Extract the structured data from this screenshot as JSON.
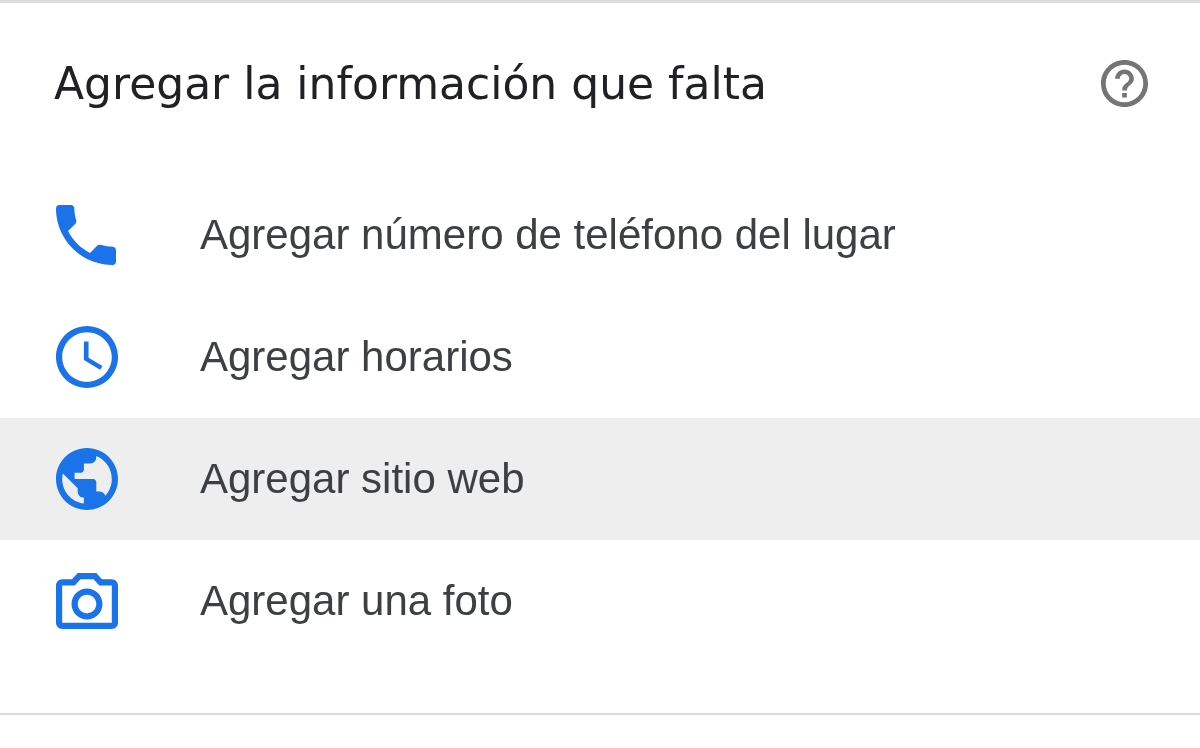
{
  "section": {
    "title": "Agregar la información que falta"
  },
  "items": [
    {
      "kind": "phone",
      "label": "Agregar número de teléfono del lugar",
      "highlighted": false
    },
    {
      "kind": "clock",
      "label": "Agregar horarios",
      "highlighted": false
    },
    {
      "kind": "globe",
      "label": "Agregar sitio web",
      "highlighted": true
    },
    {
      "kind": "camera",
      "label": "Agregar una foto",
      "highlighted": false
    }
  ]
}
